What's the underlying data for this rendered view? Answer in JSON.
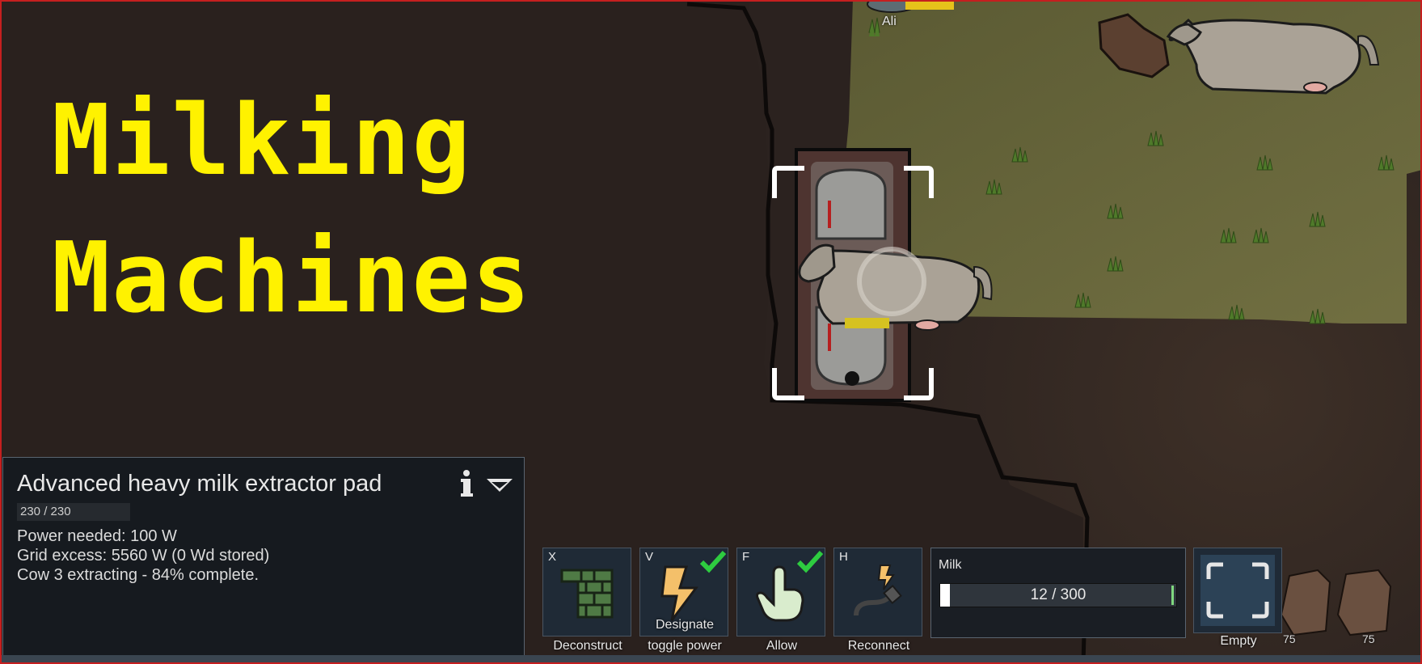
{
  "overlay_title": {
    "line1": "Milking",
    "line2": "Machines"
  },
  "pawn": {
    "name": "Ali"
  },
  "inspect_panel": {
    "title": "Advanced heavy milk extractor pad",
    "hit_points": "230 / 230",
    "lines": [
      "Power needed: 100 W",
      "Grid excess: 5560 W (0 Wd stored)",
      "Cow 3 extracting - 84% complete."
    ],
    "info_icon": "info-icon",
    "collapse_icon": "chevron-down-icon"
  },
  "commands": [
    {
      "hotkey": "X",
      "label": "Deconstruct",
      "icon": "brick-wall-icon"
    },
    {
      "hotkey": "V",
      "label": "toggle power",
      "overlay_label": "Designate",
      "icon": "lightning-icon",
      "checked": true
    },
    {
      "hotkey": "F",
      "label": "Allow",
      "icon": "hand-pointer-icon",
      "checked": true
    },
    {
      "hotkey": "H",
      "label": "Reconnect",
      "icon": "power-plug-icon"
    }
  ],
  "milk_gizmo": {
    "label": "Milk",
    "value_text": "12 / 300",
    "fraction": 0.04,
    "target_fraction": 0.97
  },
  "empty_command": {
    "label": "Empty",
    "icon": "select-frame-icon"
  },
  "item_stacks": [
    {
      "count": "75"
    },
    {
      "count": "75"
    }
  ],
  "colors": {
    "title_text": "#fff200",
    "check": "#2ecc40",
    "frame_border": "#c51f1f",
    "panel_bg": "#161a1f",
    "grass": "#6c6a3a",
    "dirt": "#2a211e"
  }
}
